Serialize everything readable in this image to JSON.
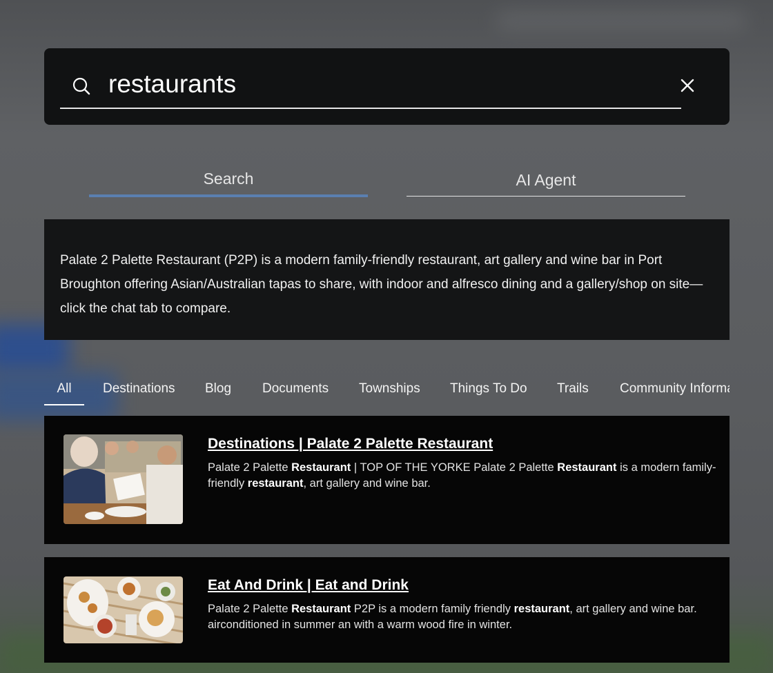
{
  "search": {
    "query": "restaurants",
    "icon": "search-icon",
    "clear_icon": "close-icon"
  },
  "mode_tabs": [
    {
      "label": "Search",
      "active": true
    },
    {
      "label": "AI Agent",
      "active": false
    }
  ],
  "ai_summary": "Palate 2 Palette Restaurant (P2P) is a modern family-friendly restaurant, art gallery and wine bar in Port Broughton offering Asian/Australian tapas to share, with indoor and alfresco dining and a gallery/shop on site—click the chat tab to compare.",
  "category_tabs": [
    {
      "label": "All",
      "active": true
    },
    {
      "label": "Destinations",
      "active": false
    },
    {
      "label": "Blog",
      "active": false
    },
    {
      "label": "Documents",
      "active": false
    },
    {
      "label": "Townships",
      "active": false
    },
    {
      "label": "Things To Do",
      "active": false
    },
    {
      "label": "Trails",
      "active": false
    },
    {
      "label": "Community Informa",
      "active": false
    }
  ],
  "results": [
    {
      "title": "Destinations | Palate 2 Palette Restaurant",
      "snippet": [
        {
          "t": "Palate 2 Palette ",
          "b": false
        },
        {
          "t": "Restaurant",
          "b": true
        },
        {
          "t": " | TOP OF THE YORKE Palate 2 Palette ",
          "b": false
        },
        {
          "t": "Restaurant",
          "b": true
        },
        {
          "t": " is a modern family-friendly ",
          "b": false
        },
        {
          "t": "restaurant",
          "b": true
        },
        {
          "t": ", art gallery and wine bar.",
          "b": false
        }
      ]
    },
    {
      "title": "Eat And Drink | Eat and Drink",
      "snippet": [
        {
          "t": "Palate 2 Palette ",
          "b": false
        },
        {
          "t": "Restaurant",
          "b": true
        },
        {
          "t": " P2P is a modern family friendly ",
          "b": false
        },
        {
          "t": "restaurant",
          "b": true
        },
        {
          "t": ", art gallery and wine bar. airconditioned in summer an with a warm wood fire in winter.",
          "b": false
        }
      ]
    }
  ],
  "colors": {
    "panel": "#111213",
    "active_tab_underline": "#5a7fb0",
    "result_bg": "#060606"
  }
}
